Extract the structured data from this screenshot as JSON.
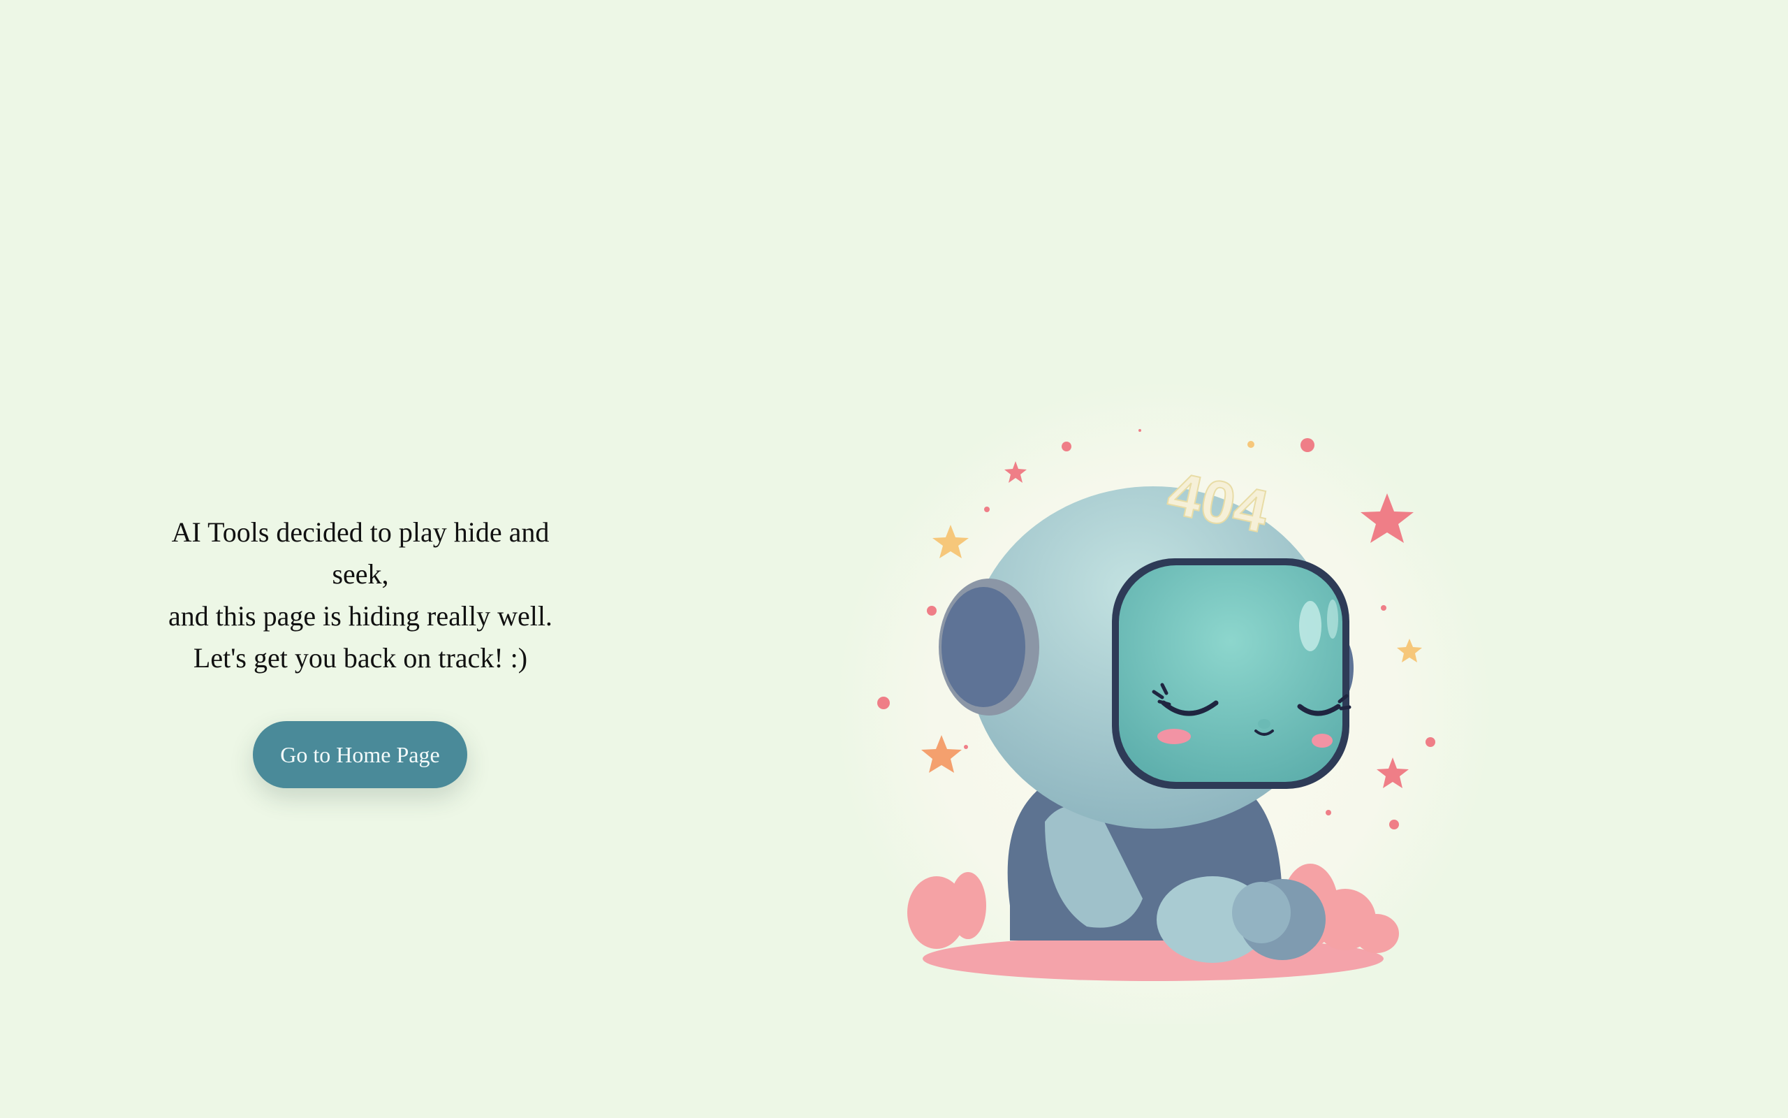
{
  "message": {
    "line1": "AI Tools decided to play hide and",
    "line2": "seek,",
    "line3": "and this page is hiding really well.",
    "line4": "Let's get you back on track! :)"
  },
  "home_button": {
    "label": "Go to Home Page"
  },
  "illustration": {
    "helmet_text": "404"
  },
  "colors": {
    "background": "#edf7e6",
    "button": "#4a8a99",
    "robot_body": "#9fc7cf",
    "visor": "#7fcbc4",
    "stars": "#ee7f86",
    "floor": "#f3a1a8"
  }
}
